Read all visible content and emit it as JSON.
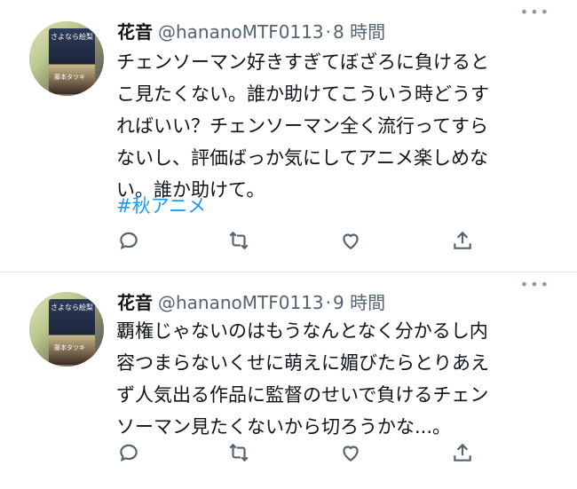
{
  "tweets": [
    {
      "name": "花音",
      "handle": "@hananoMTF0113",
      "dot": "·",
      "time": "8 時間",
      "text": "チェンソーマン好きすぎてぼざろに負けると\nこ見たくない。誰か助けてこういう時どうす\nればいい？チェンソーマン全く流行ってすら\nないし、評価ばっか気にしてアニメ楽しめな\nい。誰か助けて。",
      "hashtag": "#秋アニメ",
      "avatar_text": "さよなら絵梨",
      "avatar_text2": "藤本タツキ"
    },
    {
      "name": "花音",
      "handle": "@hananoMTF0113",
      "dot": "·",
      "time": "9 時間",
      "text": "覇権じゃないのはもうなんとなく分かるし内\n容つまらないくせに萌えに媚びたらとりあえ\nず人気出る作品に監督のせいで負けるチェン\nソーマン見たくないから切ろうかな...。",
      "avatar_text": "さよなら絵梨",
      "avatar_text2": "藤本タツキ"
    }
  ],
  "more": "•••",
  "colors": {
    "link": "#1d9bf0",
    "muted": "#536471",
    "icon": "#536471"
  },
  "icons": [
    "reply-icon",
    "retweet-icon",
    "like-icon",
    "share-icon"
  ]
}
